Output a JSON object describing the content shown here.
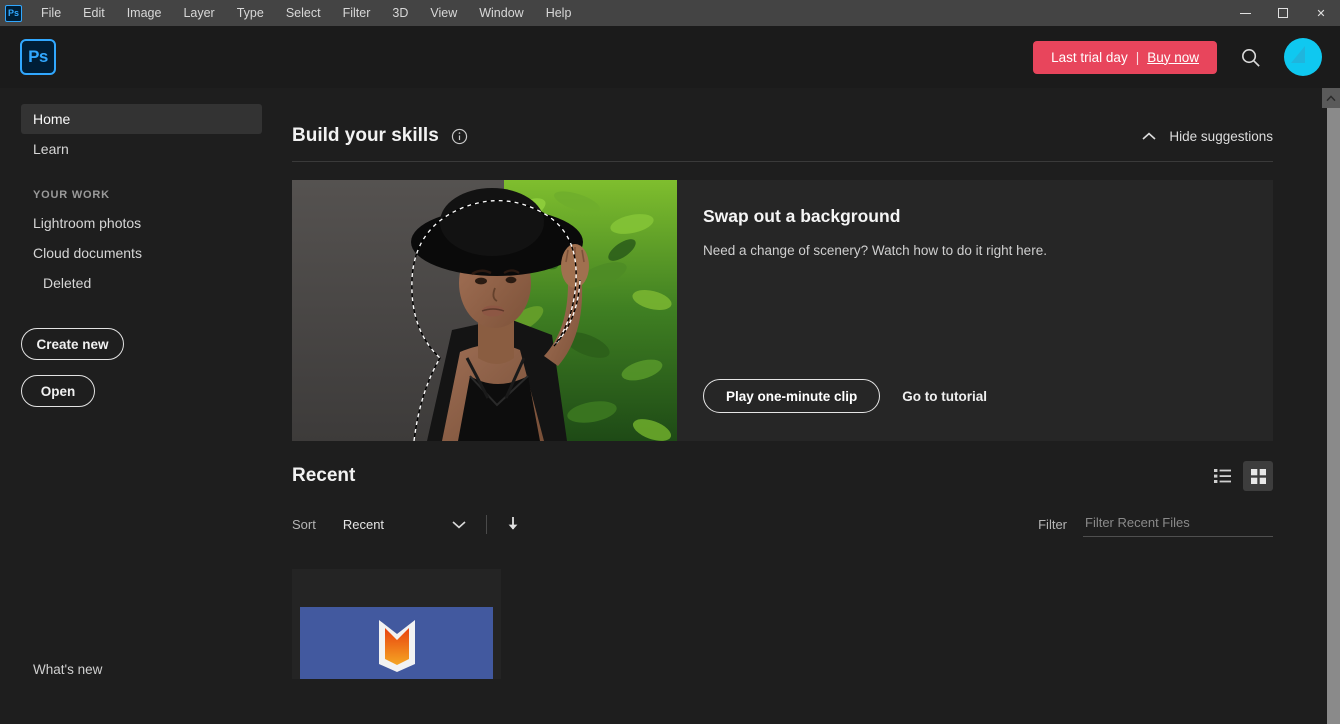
{
  "titlebar": {
    "app_icon": "ps-logo-icon",
    "menus": [
      "File",
      "Edit",
      "Image",
      "Layer",
      "Type",
      "Select",
      "Filter",
      "3D",
      "View",
      "Window",
      "Help"
    ],
    "window_controls": {
      "minimize": "minimize-icon",
      "maximize": "maximize-icon",
      "close": "✕"
    }
  },
  "header": {
    "logo_text": "Ps",
    "trial": {
      "label": "Last trial day",
      "separator": "|",
      "cta": "Buy now",
      "pill_color": "#e8455c"
    },
    "search_icon": "search-icon",
    "avatar": "user-avatar"
  },
  "sidebar": {
    "items": [
      {
        "label": "Home",
        "active": true
      },
      {
        "label": "Learn",
        "active": false
      }
    ],
    "section_label": "YOUR WORK",
    "work_items": [
      {
        "label": "Lightroom photos",
        "sub": false
      },
      {
        "label": "Cloud documents",
        "sub": false
      },
      {
        "label": "Deleted",
        "sub": true
      }
    ],
    "create_new": "Create new",
    "open": "Open",
    "whats_new": "What's new"
  },
  "skills": {
    "title": "Build your skills",
    "info_icon": "info-icon",
    "hide_label": "Hide suggestions",
    "hide_icon": "chevron-up-icon"
  },
  "hero": {
    "title": "Swap out a background",
    "subtitle": "Need a change of scenery? Watch how to do it right here.",
    "play_button": "Play one-minute clip",
    "tutorial_link": "Go to tutorial",
    "image_alt": "woman-in-black-hat-with-selection-outline"
  },
  "recent": {
    "title": "Recent",
    "view_list_icon": "list-view-icon",
    "view_grid_icon": "grid-view-icon",
    "active_view": "grid",
    "sort_label": "Sort",
    "sort_value": "Recent",
    "sort_chevron": "chevron-down-icon",
    "sort_direction_icon": "arrow-down-icon",
    "filter_label": "Filter",
    "filter_placeholder": "Filter Recent Files",
    "filter_value": "",
    "files": [
      {
        "name": "recent-file-thumbnail",
        "thumb_color": "#42599f"
      }
    ]
  },
  "scrollbar": {
    "up_arrow": "scroll-up-icon"
  }
}
